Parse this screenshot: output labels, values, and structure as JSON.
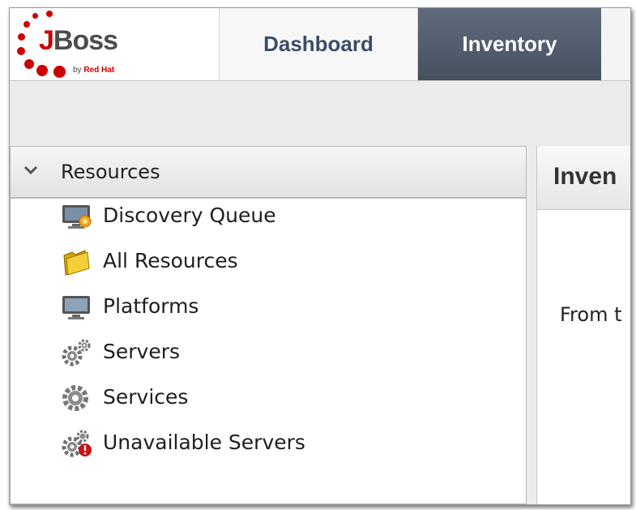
{
  "brand": {
    "logo_first_letter": "J",
    "logo_rest": "Boss",
    "logo_by": "by",
    "logo_company": "Red Hat"
  },
  "tabs": [
    {
      "label": "Dashboard",
      "selected": false
    },
    {
      "label": "Inventory",
      "selected": true
    }
  ],
  "sidebar": {
    "section_title": "Resources",
    "section_expanded": true,
    "items": [
      {
        "label": "Discovery Queue",
        "icon": "discovery-queue-icon"
      },
      {
        "label": "All Resources",
        "icon": "folder-icon"
      },
      {
        "label": "Platforms",
        "icon": "monitor-icon"
      },
      {
        "label": "Servers",
        "icon": "gears-icon"
      },
      {
        "label": "Services",
        "icon": "gear-icon"
      },
      {
        "label": "Unavailable Servers",
        "icon": "gears-unavailable-icon"
      }
    ]
  },
  "main": {
    "title": "Inven",
    "text": "From t"
  },
  "colors": {
    "brand_red": "#cc0000",
    "tab_selected_bg": "#4f5a6b",
    "tab_text": "#3b4d66"
  }
}
